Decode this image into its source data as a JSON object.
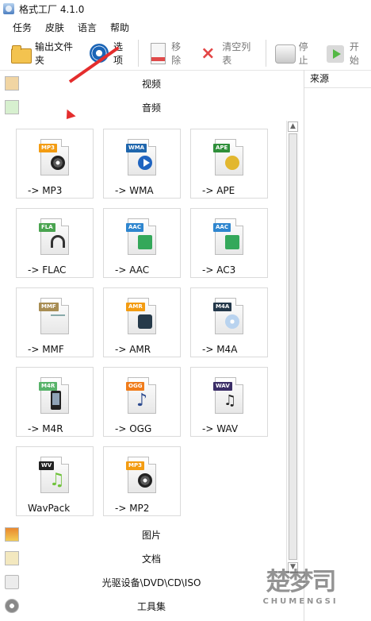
{
  "app": {
    "title": "格式工厂 4.1.0"
  },
  "menu": [
    "任务",
    "皮肤",
    "语言",
    "帮助"
  ],
  "toolbar": {
    "output_folder": "输出文件夹",
    "options": "选项",
    "remove": "移除",
    "clear_list": "清空列表",
    "stop": "停止",
    "start": "开始"
  },
  "categories": {
    "video": "视频",
    "audio": "音频",
    "images": "图片",
    "documents": "文档",
    "disc": "光驱设备\\DVD\\CD\\ISO",
    "tools": "工具集"
  },
  "tiles": [
    {
      "label": "-> MP3",
      "tag": "MP3",
      "tag_color": "#f39c12",
      "icon": "speaker-icon"
    },
    {
      "label": "-> WMA",
      "tag": "WMA",
      "tag_color": "#1f66ad",
      "icon": "play-icon"
    },
    {
      "label": "-> APE",
      "tag": "APE",
      "tag_color": "#2f8f3a",
      "icon": "ape-icon"
    },
    {
      "label": "-> FLAC",
      "tag": "FLA",
      "tag_color": "#4aa450",
      "icon": "headphones-icon"
    },
    {
      "label": "-> AAC",
      "tag": "AAC",
      "tag_color": "#2f86cf",
      "icon": "speaker-green-icon"
    },
    {
      "label": "-> AC3",
      "tag": "AAC",
      "tag_color": "#2f86cf",
      "icon": "speaker-green-icon"
    },
    {
      "label": "-> MMF",
      "tag": "MMF",
      "tag_color": "#a88d53",
      "icon": "document-music-icon"
    },
    {
      "label": "-> AMR",
      "tag": "AMR",
      "tag_color": "#f39c12",
      "icon": "phone-music-icon"
    },
    {
      "label": "-> M4A",
      "tag": "M4A",
      "tag_color": "#24384a",
      "icon": "cd-music-icon"
    },
    {
      "label": "-> M4R",
      "tag": "M4R",
      "tag_color": "#58b36a",
      "icon": "phone-icon"
    },
    {
      "label": "-> OGG",
      "tag": "OGG",
      "tag_color": "#f07c1b",
      "icon": "music-note-icon"
    },
    {
      "label": "-> WAV",
      "tag": "WAV",
      "tag_color": "#3b2e67",
      "icon": "music-notes-icon"
    },
    {
      "label": "WavPack",
      "tag": "WV",
      "tag_color": "#222222",
      "icon": "green-note-icon"
    },
    {
      "label": "-> MP2",
      "tag": "MP3",
      "tag_color": "#f39c12",
      "icon": "speaker-icon"
    }
  ],
  "source": {
    "header": "来源"
  },
  "watermark": {
    "main": "楚梦司",
    "sub": "CHUMENGSI"
  }
}
